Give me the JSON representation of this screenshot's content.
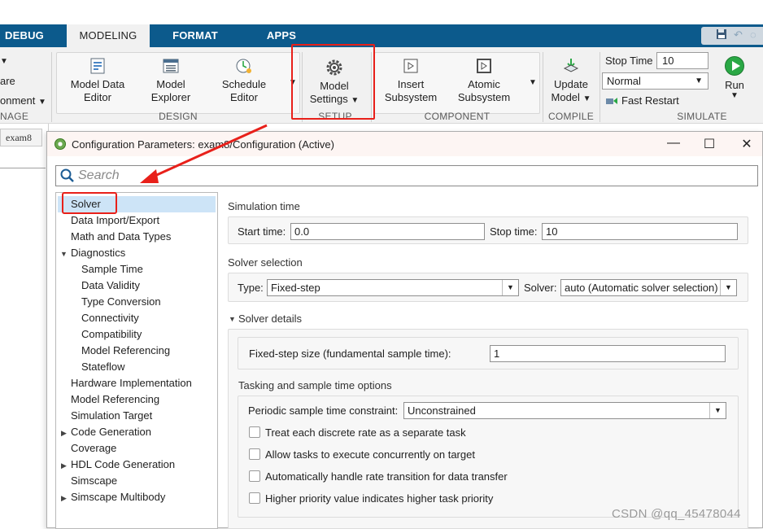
{
  "tabs": [
    "DEBUG",
    "MODELING",
    "FORMAT",
    "APPS"
  ],
  "ribbon": {
    "left_cut": {
      "line1": "are",
      "line2": "onment",
      "group": "NAGE"
    },
    "design": {
      "group_label": "DESIGN",
      "buttons": [
        {
          "line1": "Model Data",
          "line2": "Editor"
        },
        {
          "line1": "Model",
          "line2": "Explorer"
        },
        {
          "line1": "Schedule",
          "line2": "Editor"
        }
      ]
    },
    "setup": {
      "group_label": "SETUP",
      "line1": "Model",
      "line2": "Settings"
    },
    "component": {
      "group_label": "COMPONENT",
      "buttons": [
        {
          "line1": "Insert",
          "line2": "Subsystem"
        },
        {
          "line1": "Atomic",
          "line2": "Subsystem"
        }
      ]
    },
    "compile": {
      "group_label": "COMPILE",
      "line1": "Update",
      "line2": "Model"
    },
    "simulate": {
      "group_label": "SIMULATE",
      "stop_time_label": "Stop Time",
      "stop_time_value": "10",
      "mode": "Normal",
      "fast_restart": "Fast Restart",
      "run": "Run"
    }
  },
  "model_tab": "exam8",
  "dialog": {
    "title": "Configuration Parameters: exam8/Configuration (Active)",
    "search_placeholder": "Search",
    "tree": [
      {
        "label": "Solver",
        "indent": 0,
        "selected": true
      },
      {
        "label": "Data Import/Export",
        "indent": 0
      },
      {
        "label": "Math and Data Types",
        "indent": 0
      },
      {
        "label": "Diagnostics",
        "indent": 0,
        "toggle": "expanded"
      },
      {
        "label": "Sample Time",
        "indent": 1
      },
      {
        "label": "Data Validity",
        "indent": 1
      },
      {
        "label": "Type Conversion",
        "indent": 1
      },
      {
        "label": "Connectivity",
        "indent": 1
      },
      {
        "label": "Compatibility",
        "indent": 1
      },
      {
        "label": "Model Referencing",
        "indent": 1
      },
      {
        "label": "Stateflow",
        "indent": 1
      },
      {
        "label": "Hardware Implementation",
        "indent": 0
      },
      {
        "label": "Model Referencing",
        "indent": 0
      },
      {
        "label": "Simulation Target",
        "indent": 0
      },
      {
        "label": "Code Generation",
        "indent": 0,
        "toggle": "collapsed"
      },
      {
        "label": "Coverage",
        "indent": 0
      },
      {
        "label": "HDL Code Generation",
        "indent": 0,
        "toggle": "collapsed"
      },
      {
        "label": "Simscape",
        "indent": 0
      },
      {
        "label": "Simscape Multibody",
        "indent": 0,
        "toggle": "collapsed"
      }
    ],
    "simulation_time": {
      "heading": "Simulation time",
      "start_label": "Start time:",
      "start_value": "0.0",
      "stop_label": "Stop time:",
      "stop_value": "10"
    },
    "solver_selection": {
      "heading": "Solver selection",
      "type_label": "Type:",
      "type_value": "Fixed-step",
      "solver_label": "Solver:",
      "solver_value": "auto (Automatic solver selection)"
    },
    "solver_details": {
      "heading": "Solver details",
      "step_label": "Fixed-step size (fundamental sample time):",
      "step_value": "1",
      "tasking_heading": "Tasking and sample time options",
      "periodic_label": "Periodic sample time constraint:",
      "periodic_value": "Unconstrained",
      "checkboxes": [
        "Treat each discrete rate as a separate task",
        "Allow tasks to execute concurrently on target",
        "Automatically handle rate transition for data transfer",
        "Higher priority value indicates higher task priority"
      ]
    }
  },
  "watermark": "CSDN @qq_45478044",
  "colors": {
    "tabbar": "#0c5a8c",
    "highlight": "#e8201a",
    "selection": "#cde4f7"
  }
}
